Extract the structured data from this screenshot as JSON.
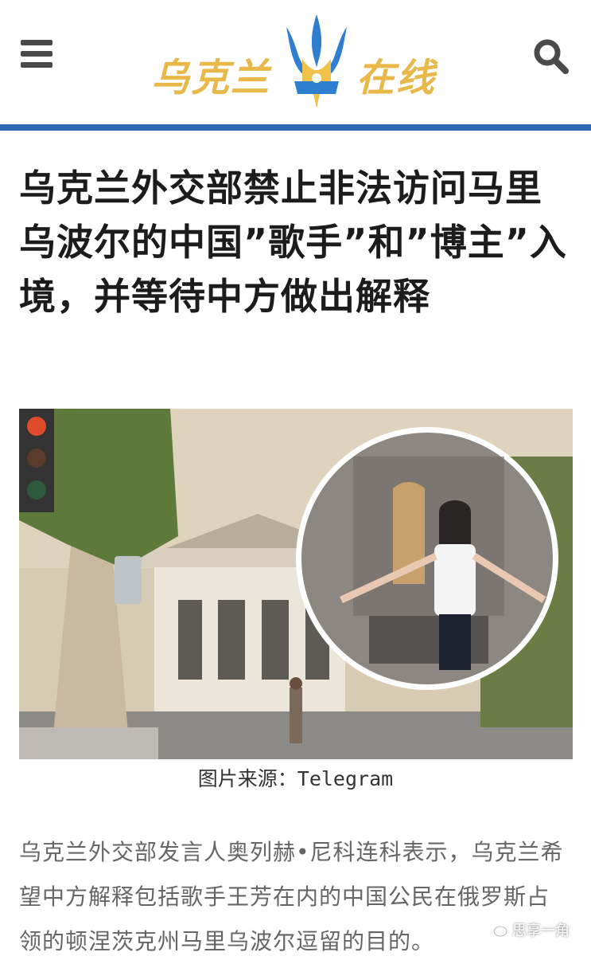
{
  "header": {
    "logo_left": "乌克兰",
    "logo_right": "在线",
    "logo_emblem": "trident-emblem",
    "menu_icon": "hamburger-menu-icon",
    "search_icon": "search-icon",
    "brand_color": "#2f6ab3",
    "logo_color": "#e9b84a"
  },
  "article": {
    "headline": "乌克兰外交部禁止非法访问马里乌波尔的中国”歌手”和”博主”入境，并等待中方做出解释",
    "image_caption": "图片来源：Telegram",
    "paragraph": "乌克兰外交部发言人奥列赫•尼科连科表示，乌克兰希望中方解释包括歌手王芳在内的中国公民在俄罗斯占领的顿涅茨克州马里乌波尔逗留的目的。"
  },
  "watermark": {
    "text": "思享一角",
    "icon": "wechat-icon"
  }
}
